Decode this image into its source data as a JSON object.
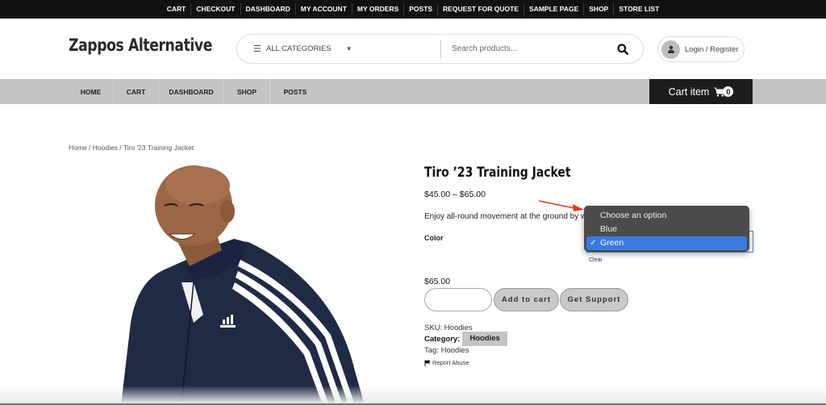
{
  "topbar": {
    "links": [
      "CART",
      "CHECKOUT",
      "DASHBOARD",
      "MY ACCOUNT",
      "MY ORDERS",
      "POSTS",
      "REQUEST FOR QUOTE",
      "SAMPLE PAGE",
      "SHOP",
      "STORE LIST"
    ]
  },
  "header": {
    "logo": "Zappos Alternative",
    "category_select": "ALL CATEGORIES",
    "search_placeholder": "Search products...",
    "login_label": "Login / Register"
  },
  "nav": {
    "items": [
      "HOME",
      "CART",
      "DASHBOARD",
      "SHOP",
      "POSTS"
    ],
    "cart_label": "Cart item",
    "cart_count": "0"
  },
  "breadcrumb": "Home / Hoodies / Tiro '23 Training Jacket",
  "product": {
    "title": "Tiro ’23 Training Jacket",
    "price_range": "$45.00 – $65.00",
    "description": "Enjoy all-round movement at the ground by we",
    "color_label": "Color",
    "color_options": [
      "Choose an option",
      "Blue",
      "Green"
    ],
    "color_selected": "Green",
    "checkmark": "✓",
    "clear_label": "Clear",
    "variation_price": "$65.00",
    "quantity": "",
    "add_to_cart": "Add to cart",
    "get_support": "Get Support",
    "sku": "SKU: Hoodies",
    "category_label": "Category:",
    "category_value": "Hoodies",
    "tag": "Tag: Hoodies",
    "report_abuse": "Report Abuse",
    "brand_logo_text": "adidas"
  },
  "colors": {
    "topbar_bg": "#111111",
    "nav_bg": "#c4c4c4",
    "cart_bg": "#1c1c1c",
    "dropdown_bg": "#4b4b4d",
    "dropdown_selected": "#3a7ae0",
    "annotation_arrow": "#e23a22",
    "jacket": "#1f2a44"
  }
}
